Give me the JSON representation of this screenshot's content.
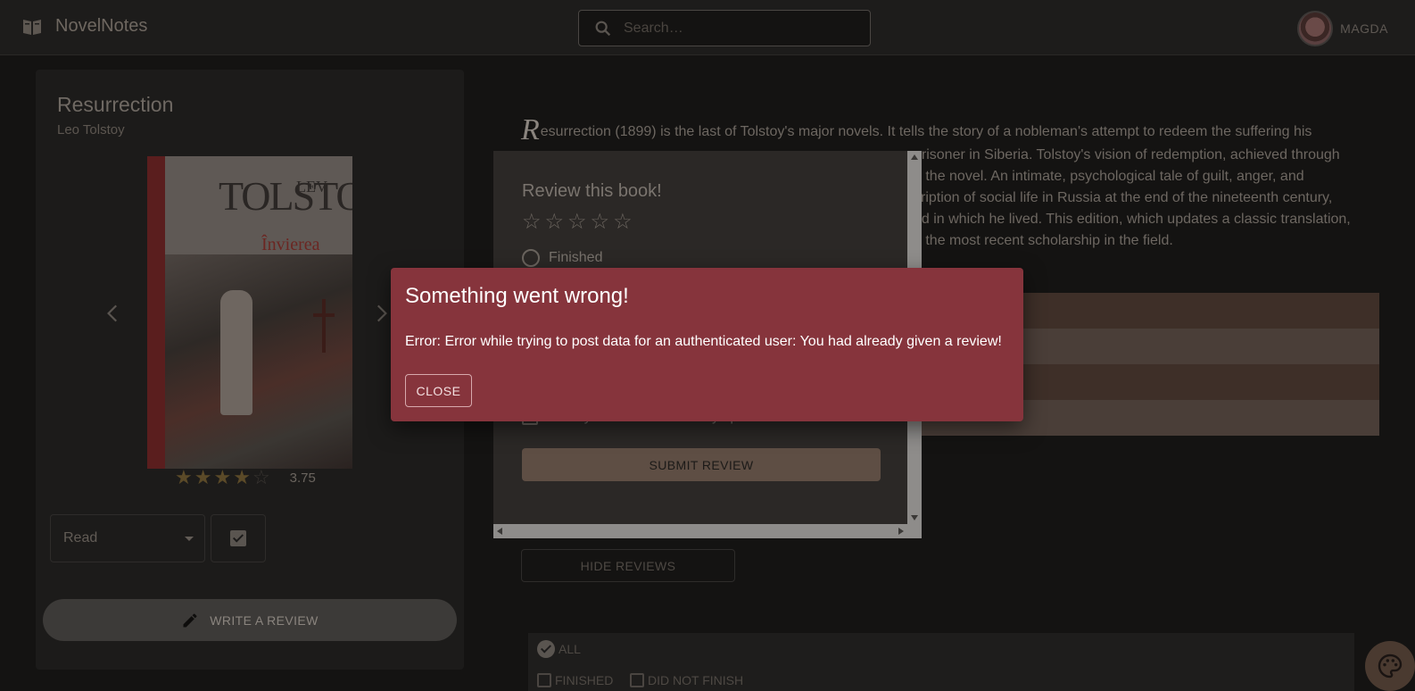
{
  "app": {
    "name": "NovelNotes"
  },
  "header": {
    "search_placeholder": "Search…",
    "user_name": "MAGDA"
  },
  "book": {
    "title": "Resurrection",
    "author": "Leo Tolstoy",
    "cover": {
      "author_first": "LEV",
      "author_last": "TOLSTOI",
      "title": "Învierea"
    },
    "rating_value": "3.75",
    "rating_stars": 3.75,
    "shelf_status": "Read",
    "write_review_label": "WRITE A REVIEW"
  },
  "description": {
    "drop_cap": "R",
    "line1": "esurrection (1899) is the last of Tolstoy's major novels. It tells the story of a nobleman's attempt to redeem the suffering his",
    "line2": "prisoner in Siberia. Tolstoy's vision of redemption, achieved through",
    "line3": "e the novel. An intimate, psychological tale of guilt, anger, and",
    "line4": "cription of social life in Russia at the end of the nineteenth century,",
    "line5": "rld in which he lived. This edition, which updates a classic translation,",
    "line6": "n the most recent scholarship in the field."
  },
  "reviews": {
    "hide_label": "HIDE REVIEWS",
    "filters": {
      "all_label": "ALL",
      "finished_label": "FINISHED",
      "dnf_label": "DID NOT FINISH"
    }
  },
  "review_form": {
    "title": "Review this book!",
    "finished_label": "Finished",
    "spoiler_label": "Does your review have any spoilers?",
    "submit_label": "SUBMIT REVIEW"
  },
  "error_dialog": {
    "title": "Something went wrong!",
    "message": "Error: Error while trying to post data for an authenticated user: You had already given a review!",
    "close_label": "CLOSE"
  },
  "colors": {
    "error_bg": "#86343c",
    "accent": "#5e4e44",
    "background": "#141312"
  }
}
